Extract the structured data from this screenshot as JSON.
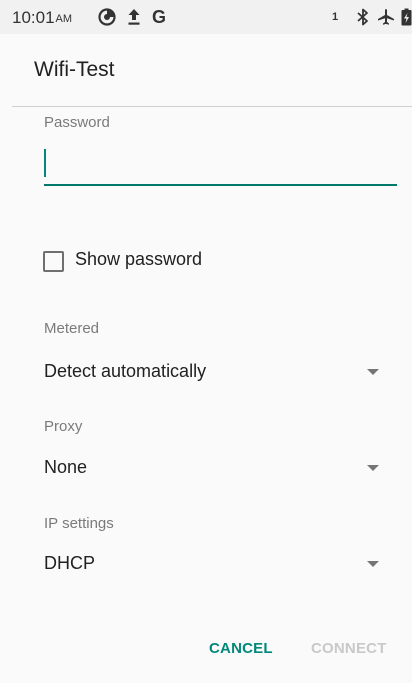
{
  "status_bar": {
    "time": "10:01",
    "ampm": "AM",
    "g_label": "G",
    "sim_number": "1",
    "icons": [
      "data-saver-icon",
      "upload-icon",
      "google-icon",
      "bluetooth-icon",
      "airplane-icon",
      "battery-icon"
    ]
  },
  "dialog": {
    "title": "Wifi-Test",
    "password": {
      "label": "Password",
      "value": "",
      "placeholder": ""
    },
    "show_password": {
      "label": "Show password",
      "checked": false
    },
    "metered": {
      "label": "Metered",
      "value": "Detect automatically"
    },
    "proxy": {
      "label": "Proxy",
      "value": "None"
    },
    "ip_settings": {
      "label": "IP settings",
      "value": "DHCP"
    },
    "buttons": {
      "cancel": "CANCEL",
      "connect": "CONNECT"
    }
  },
  "colors": {
    "accent": "#00897b",
    "disabled": "#c9c9c9"
  }
}
